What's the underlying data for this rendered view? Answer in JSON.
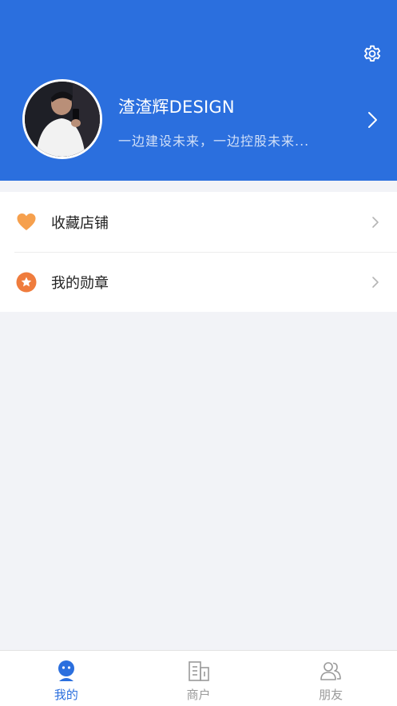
{
  "profile": {
    "name": "渣渣辉DESIGN",
    "motto": "一边建设未来，一边控股未来..."
  },
  "menu": {
    "items": [
      {
        "label": "收藏店铺",
        "icon": "heart-icon",
        "color": "#f6a04d"
      },
      {
        "label": "我的勋章",
        "icon": "medal-star-icon",
        "color": "#ef7c3d"
      }
    ]
  },
  "tabs": [
    {
      "label": "我的",
      "icon": "profile-face-icon",
      "active": true
    },
    {
      "label": "商户",
      "icon": "merchant-building-icon",
      "active": false
    },
    {
      "label": "朋友",
      "icon": "friends-icon",
      "active": false
    }
  ],
  "colors": {
    "primary": "#2b6fde",
    "background": "#f2f3f7",
    "tab_inactive": "#9a9a9a"
  }
}
